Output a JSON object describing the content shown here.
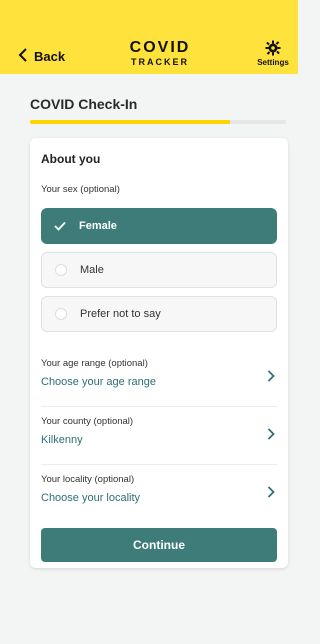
{
  "header": {
    "back_label": "Back",
    "logo_line1": "COVID",
    "logo_line2": "TRACKER",
    "settings_label": "Settings",
    "brand_color": "#ffe23b"
  },
  "page": {
    "title": "COVID Check-In",
    "progress_fraction": 0.78
  },
  "card": {
    "section_title": "About you",
    "sex_label": "Your sex (optional)",
    "sex_options": [
      {
        "label": "Female",
        "selected": true
      },
      {
        "label": "Male",
        "selected": false
      },
      {
        "label": "Prefer not to say",
        "selected": false
      }
    ],
    "age": {
      "label": "Your age range (optional)",
      "value": "Choose your age range"
    },
    "county": {
      "label": "Your county (optional)",
      "value": "Kilkenny"
    },
    "locality": {
      "label": "Your locality (optional)",
      "value": "Choose your locality"
    },
    "continue_label": "Continue",
    "accent_color": "#3d7c79"
  },
  "icons": {
    "back": "chevron-left-icon",
    "settings": "gear-icon",
    "check": "check-icon",
    "row_chevron": "chevron-right-icon"
  }
}
